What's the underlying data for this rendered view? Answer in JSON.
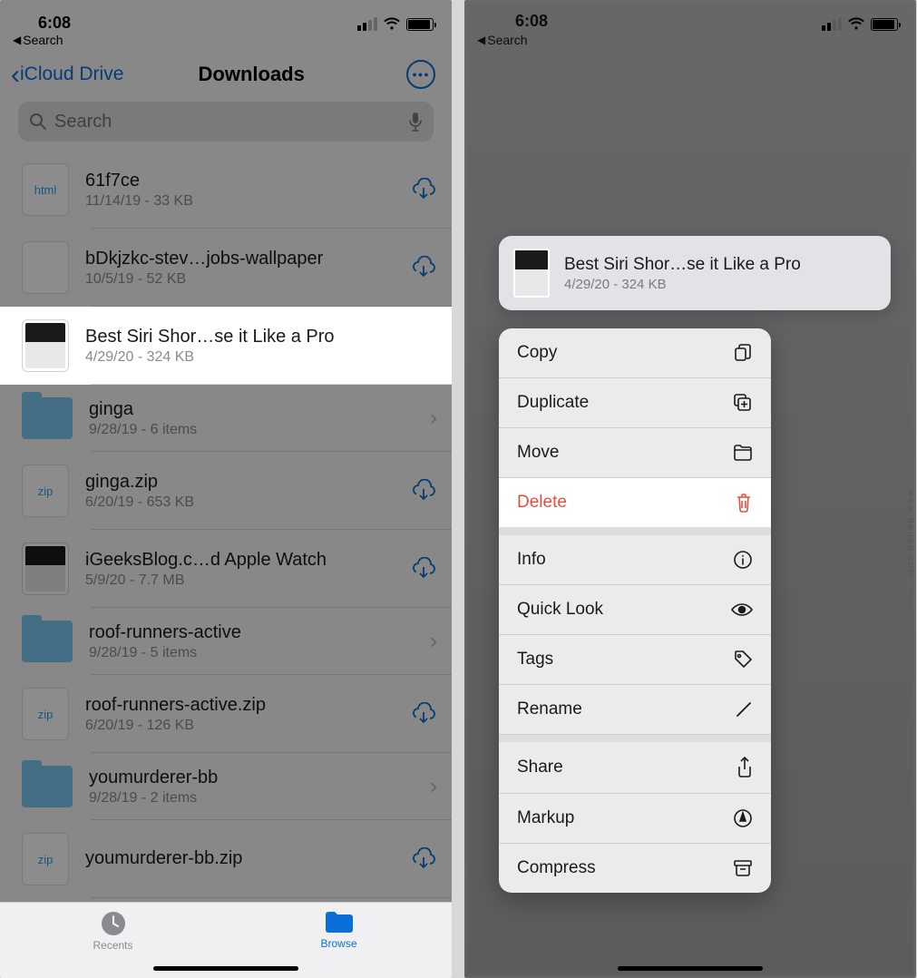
{
  "status": {
    "time": "6:08",
    "back_label": "Search"
  },
  "nav": {
    "back": "iCloud Drive",
    "title": "Downloads"
  },
  "search": {
    "placeholder": "Search"
  },
  "files": [
    {
      "name": "61f7ce",
      "sub": "11/14/19 - 33 KB",
      "thumb": "html",
      "action": "cloud"
    },
    {
      "name": "bDkjzkc-stev…jobs-wallpaper",
      "sub": "10/5/19 - 52 KB",
      "thumb": "apple",
      "action": "cloud"
    },
    {
      "name": "Best Siri Shor…se it Like a Pro",
      "sub": "4/29/20 - 324 KB",
      "thumb": "doc",
      "action": "",
      "highlight": true
    },
    {
      "name": "ginga",
      "sub": "9/28/19 - 6 items",
      "thumb": "folder",
      "action": "chev"
    },
    {
      "name": "ginga.zip",
      "sub": "6/20/19 - 653 KB",
      "thumb": "zip",
      "action": "cloud"
    },
    {
      "name": "iGeeksBlog.c…d Apple Watch",
      "sub": "5/9/20 - 7.7 MB",
      "thumb": "doc",
      "action": "cloud"
    },
    {
      "name": "roof-runners-active",
      "sub": "9/28/19 - 5 items",
      "thumb": "folder",
      "action": "chev"
    },
    {
      "name": "roof-runners-active.zip",
      "sub": "6/20/19 - 126 KB",
      "thumb": "zip",
      "action": "cloud"
    },
    {
      "name": "youmurderer-bb",
      "sub": "9/28/19 - 2 items",
      "thumb": "folder",
      "action": "chev"
    },
    {
      "name": "youmurderer-bb.zip",
      "sub": "",
      "thumb": "zip",
      "action": "cloud"
    }
  ],
  "tabs": {
    "recents": "Recents",
    "browse": "Browse"
  },
  "selected": {
    "title": "Best Siri Shor…se it Like a Pro",
    "sub": "4/29/20 - 324 KB"
  },
  "menu": {
    "copy": "Copy",
    "duplicate": "Duplicate",
    "move": "Move",
    "delete": "Delete",
    "info": "Info",
    "quicklook": "Quick Look",
    "tags": "Tags",
    "rename": "Rename",
    "share": "Share",
    "markup": "Markup",
    "compress": "Compress"
  },
  "watermark": "www.deuaq.com"
}
